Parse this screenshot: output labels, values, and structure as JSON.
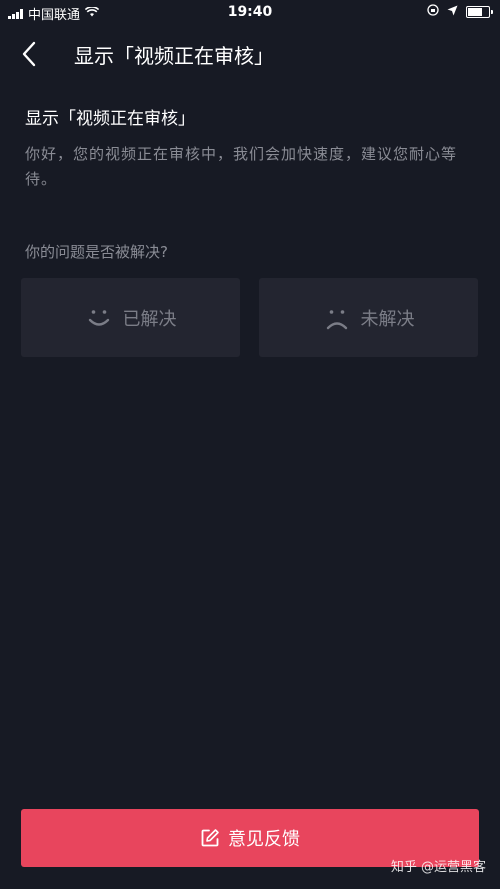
{
  "status_bar": {
    "carrier": "中国联通",
    "time": "19:40"
  },
  "header": {
    "title": "显示「视频正在审核」"
  },
  "content": {
    "title": "显示「视频正在审核」",
    "body": "你好，您的视频正在审核中，我们会加快速度，建议您耐心等待。",
    "question": "你的问题是否被解决?"
  },
  "feedback_options": {
    "resolved_label": "已解决",
    "resolved_icon": "smile-icon",
    "unresolved_label": "未解决",
    "unresolved_icon": "frown-icon"
  },
  "bottom_button": {
    "label": "意见反馈",
    "icon": "edit-icon"
  },
  "watermark": "知乎 @运营黑客",
  "colors": {
    "background": "#171a24",
    "card": "#232530",
    "accent": "#e8455d"
  }
}
